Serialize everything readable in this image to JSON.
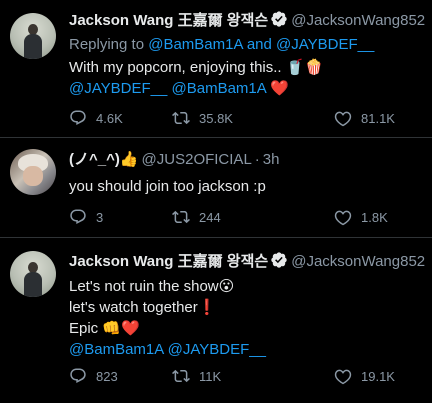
{
  "tweets": [
    {
      "name": "Jackson Wang 王嘉爾 왕잭슨",
      "handle": "@JacksonWang852",
      "replying_prefix": "Replying to",
      "replying_to_1": "@BamBam1A",
      "replying_and": "and",
      "replying_to_2": "@JAYBDEF__",
      "lines": [
        {
          "text": "With my popcorn, enjoying this..",
          "emoji": "🥤🍿"
        },
        {
          "mention_1": "@JAYBDEF__",
          "mention_2": "@BamBam1A",
          "emoji": "❤️"
        }
      ],
      "replies": "4.6K",
      "retweets": "35.8K",
      "likes": "81.1K"
    },
    {
      "name": "(ノ^_^)👍",
      "handle": "@JUS2OFICIAL",
      "separator": "·",
      "time": "3h",
      "text": "you should join too jackson :p",
      "replies": "3",
      "retweets": "244",
      "likes": "1.8K"
    },
    {
      "name": "Jackson Wang 王嘉爾 왕잭슨",
      "handle": "@JacksonWang852",
      "lines": [
        {
          "text": "Let's not ruin the show",
          "emoji": "😮"
        },
        {
          "text": "let's watch together",
          "emoji": "❗"
        },
        {
          "text": "Epic",
          "emoji": "👊❤️"
        },
        {
          "mention_1": "@BamBam1A",
          "mention_2": "@JAYBDEF__"
        }
      ],
      "replies": "823",
      "retweets": "11K",
      "likes": "19.1K"
    }
  ],
  "icons": {
    "avatar_1": "avatar-jackson",
    "avatar_2": "avatar-jus",
    "verified": "verified-badge-icon",
    "reply": "reply-icon",
    "retweet": "retweet-icon",
    "like": "heart-icon"
  },
  "colors": {
    "background": "#000000",
    "text": "#e7e9ea",
    "muted": "#8b98a5",
    "link": "#1d9bf0",
    "separator": "#2f3336"
  }
}
